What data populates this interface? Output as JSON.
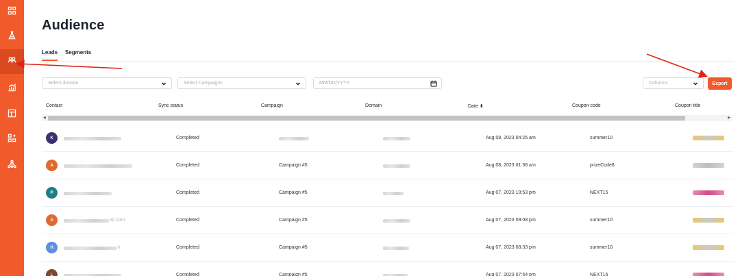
{
  "colors": {
    "brand": "#f15a2b",
    "sidebar_active": "#d94a1f",
    "annotation": "#e0241c"
  },
  "sidebar": {
    "items": [
      {
        "icon": "grid-icon",
        "name": "sidebar-item-dashboard",
        "active": false
      },
      {
        "icon": "flask-icon",
        "name": "sidebar-item-experiments",
        "active": false
      },
      {
        "icon": "users-icon",
        "name": "sidebar-item-audience",
        "active": true
      },
      {
        "icon": "chart-icon",
        "name": "sidebar-item-analytics",
        "active": false
      },
      {
        "icon": "layout-icon",
        "name": "sidebar-item-templates",
        "active": false
      },
      {
        "icon": "widgets-icon",
        "name": "sidebar-item-integrations",
        "active": false
      },
      {
        "icon": "network-icon",
        "name": "sidebar-item-network",
        "active": false
      }
    ]
  },
  "page": {
    "title": "Audience"
  },
  "tabs": [
    {
      "label": "Leads",
      "active": true
    },
    {
      "label": "Segments",
      "active": false
    }
  ],
  "filters": {
    "domain_placeholder": "Select domain",
    "campaigns_placeholder": "Select Campaigns",
    "date_placeholder": "MM/DD/YYYY",
    "columns_placeholder": "Columns",
    "export_label": "Export"
  },
  "table": {
    "headers": {
      "contact": "Contact",
      "sync_status": "Sync status",
      "campaign": "Campaign",
      "domain": "Domain",
      "date": "Date ⬍",
      "coupon_code": "Coupon code",
      "coupon_title": "Coupon title"
    },
    "rows": [
      {
        "initial": "K",
        "avatar_color": "#3d2f73",
        "contact_suffix": "",
        "sync_status": "Completed",
        "campaign": "",
        "date": "Aug 08, 2023 04:25 am",
        "coupon_code": "summer10",
        "coupon_colors": [
          "#e8c96a",
          "#c9c9c9"
        ]
      },
      {
        "initial": "A",
        "avatar_color": "#dd6b2f",
        "contact_suffix": "",
        "sync_status": "Completed",
        "campaign": "Campaign #5",
        "date": "Aug 08, 2023 01:58 am",
        "coupon_code": "prizeCode8",
        "coupon_colors": [
          "#d2d2d2",
          "#bdbdbd"
        ]
      },
      {
        "initial": "P",
        "avatar_color": "#1f7f86",
        "contact_suffix": "",
        "sync_status": "Completed",
        "campaign": "Campaign #5",
        "date": "Aug 07, 2023 10:53 pm",
        "coupon_code": "NEXT15",
        "coupon_colors": [
          "#e58fb4",
          "#d44b86"
        ]
      },
      {
        "initial": "A",
        "avatar_color": "#dd6b2f",
        "contact_suffix": "ail.com",
        "sync_status": "Completed",
        "campaign": "Campaign #5",
        "date": "Aug 07, 2023 09:08 pm",
        "coupon_code": "summer10",
        "coupon_colors": [
          "#e8c96a",
          "#c9c9c9"
        ]
      },
      {
        "initial": "H",
        "avatar_color": "#5f8ee0",
        "contact_suffix": "k",
        "sync_status": "Completed",
        "campaign": "Campaign #5",
        "date": "Aug 07, 2023 08:33 pm",
        "coupon_code": "summer10",
        "coupon_colors": [
          "#e8c96a",
          "#c9c9c9"
        ]
      },
      {
        "initial": "L",
        "avatar_color": "#7a4a2e",
        "contact_suffix": "",
        "sync_status": "Completed",
        "campaign": "Campaign #5",
        "date": "Aug 07, 2023 07:54 pm",
        "coupon_code": "NEXT15",
        "coupon_colors": [
          "#e58fb4",
          "#d44b86"
        ]
      }
    ]
  }
}
